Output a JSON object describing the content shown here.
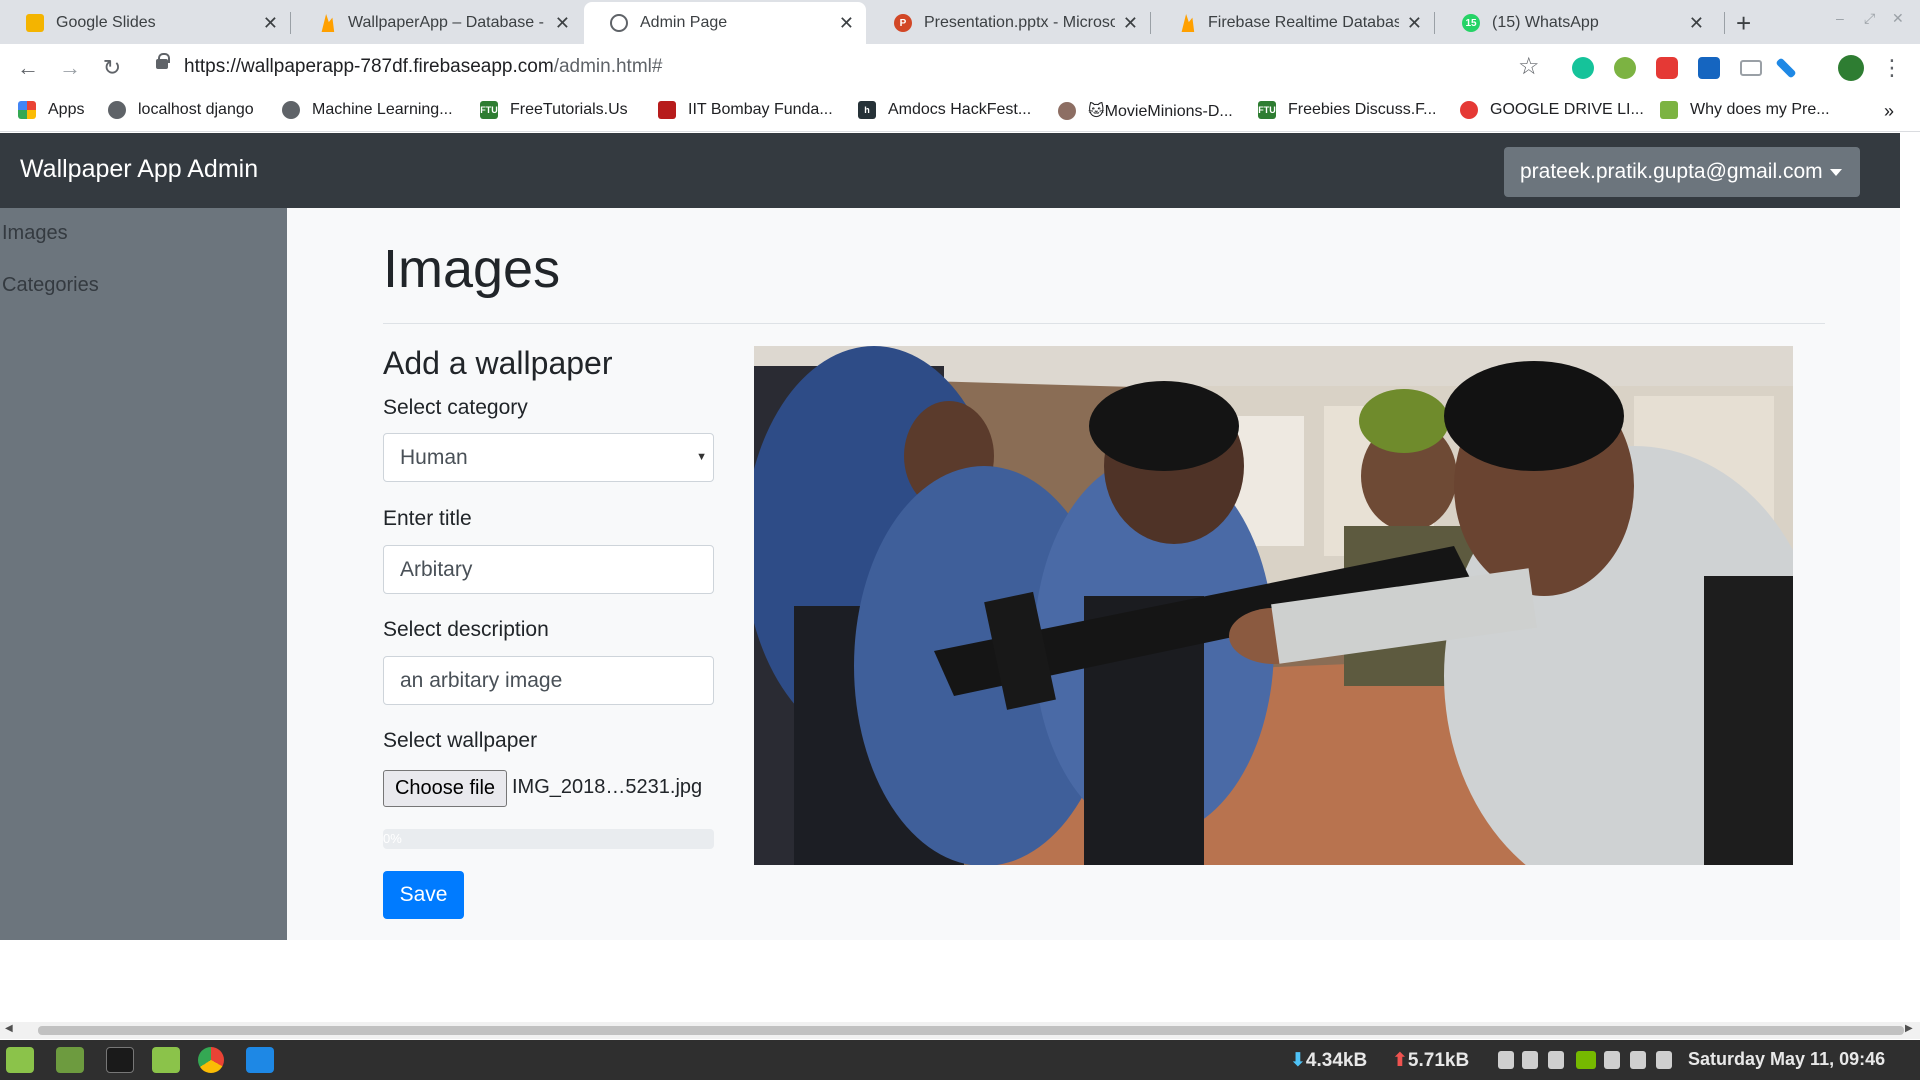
{
  "browser": {
    "tabs": [
      {
        "title": "Google Slides",
        "icon": "google-slides-icon",
        "color": "#f4b400"
      },
      {
        "title": "WallpaperApp – Database -",
        "icon": "firebase-icon",
        "color": "#ffa000"
      },
      {
        "title": "Admin Page",
        "icon": "globe-icon",
        "color": "#5f6368"
      },
      {
        "title": "Presentation.pptx - Microsoft",
        "icon": "powerpoint-icon",
        "color": "#d24726"
      },
      {
        "title": "Firebase Realtime Database",
        "icon": "firebase-icon",
        "color": "#ffa000"
      },
      {
        "title": "(15) WhatsApp",
        "icon": "whatsapp-icon",
        "color": "#25d366"
      }
    ],
    "url_host": "https://wallpaperapp-787df.firebaseapp.com",
    "url_path": "/admin.html#",
    "bookmarks": [
      "Apps",
      "localhost django",
      "Machine Learning...",
      "FreeTutorials.Us",
      "IIT Bombay Funda...",
      "Amdocs HackFest...",
      "🐱MovieMinions-D...",
      "Freebies Discuss.F...",
      "GOOGLE DRIVE LI...",
      "Why does my Pre..."
    ],
    "more_bookmarks": "»"
  },
  "app": {
    "brand": "Wallpaper App Admin",
    "user_email": "prateek.pratik.gupta@gmail.com",
    "sidebar": [
      "Images",
      "Categories"
    ],
    "page_title": "Images",
    "form": {
      "heading": "Add a wallpaper",
      "category_label": "Select category",
      "category_value": "Human",
      "title_label": "Enter title",
      "title_value": "Arbitary",
      "description_label": "Select description",
      "description_value": "an arbitary image",
      "wallpaper_label": "Select wallpaper",
      "choose_file_label": "Choose file",
      "file_name": "IMG_2018…5231.jpg",
      "progress_text": "0%",
      "progress": 0,
      "save_label": "Save"
    },
    "preview_image": "photo of people at an exhibition, a young man holding a rifle"
  },
  "taskbar": {
    "download_rate": "4.34kB",
    "upload_rate": "5.71kB",
    "clock": "Saturday May 11, 09:46"
  },
  "colors": {
    "navbar": "#343a40",
    "sidebar": "#6c757d",
    "primary": "#007bff"
  }
}
